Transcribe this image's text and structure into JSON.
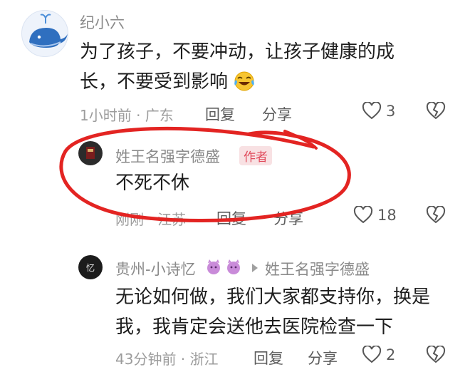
{
  "comment1": {
    "username": "纪小六",
    "text_line1": "为了孩子，不要冲动，让孩子健康的成",
    "text_line2": "长，不要受到影响",
    "emoji": "laughing-crying-emoji",
    "time_location": "1小时前 · 广东",
    "reply_label": "回复",
    "share_label": "分享",
    "like_count": "3",
    "avatar_icon": "whale-icon"
  },
  "reply1": {
    "username": "姓王名强字德盛",
    "badge": "作者",
    "text": "不死不休",
    "time_location": "刚刚 · 江苏",
    "reply_label": "回复",
    "share_label": "分享",
    "like_count": "18"
  },
  "reply2": {
    "username": "贵州-小诗忆",
    "reply_to": "姓王名强字德盛",
    "text_line1": "无论如何做，我们大家都支持你，换是",
    "text_line2": "我，我肯定会送他去医院检查一下",
    "time_location": "43分钟前 · 浙江",
    "reply_label": "回复",
    "share_label": "分享",
    "like_count": "2"
  },
  "colors": {
    "annotation_circle": "#e32422",
    "author_badge_bg": "#f8e1e3",
    "author_badge_text": "#e0495a"
  }
}
